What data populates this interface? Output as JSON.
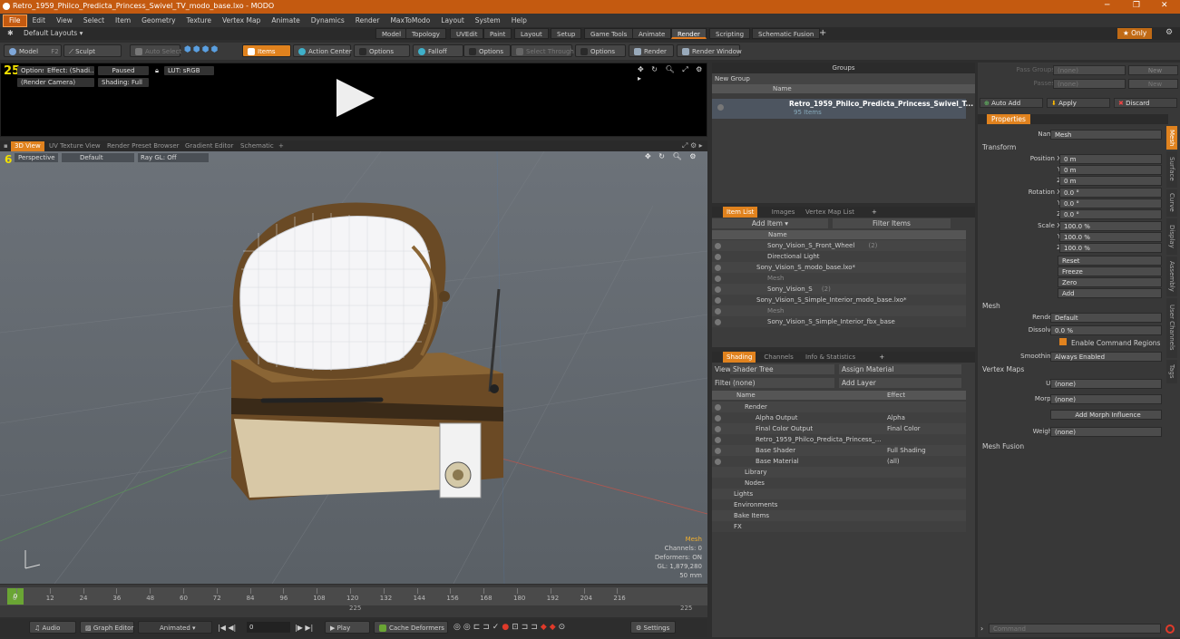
{
  "window": {
    "title": "Retro_1959_Philco_Predicta_Princess_Swivel_TV_modo_base.lxo - MODO"
  },
  "menu": [
    "File",
    "Edit",
    "View",
    "Select",
    "Item",
    "Geometry",
    "Texture",
    "Vertex Map",
    "Animate",
    "Dynamics",
    "Render",
    "MaxToModo",
    "Layout",
    "System",
    "Help"
  ],
  "layout_bar": {
    "layouts": "Default Layouts ▾",
    "tabs": [
      "Model",
      "Topology",
      "UVEdit",
      "Paint",
      "Layout",
      "Setup",
      "Game Tools",
      "Animate",
      "Render",
      "Scripting",
      "Schematic Fusion"
    ],
    "active": "Render",
    "only": "★ Only"
  },
  "toolbar": {
    "model": "Model",
    "model_key": "F2",
    "sculpt": "Sculpt",
    "auto_select": "Auto Select",
    "items": "Items",
    "action_center": "Action Center",
    "options1": "Options",
    "falloff": "Falloff",
    "options2": "Options",
    "select_through": "Select Through",
    "options3": "Options",
    "render": "Render",
    "render_window": "Render Window"
  },
  "render_view": {
    "options": "Options",
    "effect": "Effect: (Shadi...",
    "paused": "Paused",
    "lut": "LUT: sRGB",
    "camera": "(Render Camera)",
    "shading": "Shading: Full",
    "frame_num": "25"
  },
  "viewport_tabs": [
    "3D View",
    "UV Texture View",
    "Render Preset Browser",
    "Gradient Editor",
    "Schematic"
  ],
  "viewport": {
    "perspective": "Perspective",
    "default": "Default",
    "raygl": "Ray GL: Off",
    "mesh": "Mesh",
    "channels": "Channels: 0",
    "deformers": "Deformers: ON",
    "gl": "GL: 1,879,280",
    "size": "50 mm",
    "num": "6"
  },
  "timeline": {
    "ticks": [
      "0",
      "12",
      "24",
      "36",
      "48",
      "60",
      "72",
      "84",
      "96",
      "108",
      "120",
      "132",
      "144",
      "156",
      "168",
      "180",
      "192",
      "204",
      "216"
    ],
    "sub1": "225",
    "sub2": "225",
    "current": "0"
  },
  "bottom": {
    "audio": "Audio",
    "graph_editor": "Graph Editor",
    "animated": "Animated",
    "play": "Play",
    "cache": "Cache Deformers",
    "settings": "Settings",
    "frame": "0"
  },
  "groups": {
    "title": "Groups",
    "new_group": "New Group",
    "name_col": "Name",
    "item_name": "Retro_1959_Philco_Predicta_Princess_Swivel_T...",
    "item_count": "95 Items"
  },
  "item_list": {
    "tabs": [
      "Item List",
      "Images",
      "Vertex Map List"
    ],
    "add_item": "Add Item",
    "filter": "Filter Items",
    "name_col": "Name",
    "rows": [
      {
        "indent": 3,
        "label": "Sony_Vision_S_Front_Wheel",
        "suffix": "(2)",
        "grey": false
      },
      {
        "indent": 3,
        "label": "Directional Light",
        "suffix": "",
        "grey": false
      },
      {
        "indent": 2,
        "label": "Sony_Vision_S_modo_base.lxo*",
        "suffix": "",
        "grey": false
      },
      {
        "indent": 3,
        "label": "Mesh",
        "suffix": "",
        "grey": true
      },
      {
        "indent": 3,
        "label": "Sony_Vision_S",
        "suffix": "(2)",
        "grey": false
      },
      {
        "indent": 2,
        "label": "Sony_Vision_S_Simple_Interior_modo_base.lxo*",
        "suffix": "",
        "grey": false
      },
      {
        "indent": 3,
        "label": "Mesh",
        "suffix": "",
        "grey": true
      },
      {
        "indent": 3,
        "label": "Sony_Vision_S_Simple_Interior_fbx_base",
        "suffix": "",
        "grey": false
      }
    ]
  },
  "shading": {
    "tabs": [
      "Shading",
      "Channels",
      "Info & Statistics"
    ],
    "view_label": "View",
    "view_value": "Shader Tree",
    "assign": "Assign Material",
    "filter_label": "Filter",
    "filter_value": "(none)",
    "add_layer": "Add Layer",
    "name_col": "Name",
    "effect_col": "Effect",
    "rows": [
      {
        "indent": 1,
        "label": "Render",
        "effect": ""
      },
      {
        "indent": 2,
        "label": "Alpha Output",
        "effect": "Alpha"
      },
      {
        "indent": 2,
        "label": "Final Color Output",
        "effect": "Final Color"
      },
      {
        "indent": 2,
        "label": "Retro_1959_Philco_Predicta_Princess_...",
        "effect": ""
      },
      {
        "indent": 2,
        "label": "Base Shader",
        "effect": "Full Shading"
      },
      {
        "indent": 2,
        "label": "Base Material",
        "effect": "(all)"
      },
      {
        "indent": 1,
        "label": "Library",
        "effect": ""
      },
      {
        "indent": 1,
        "label": "Nodes",
        "effect": ""
      },
      {
        "indent": 0,
        "label": "Lights",
        "effect": ""
      },
      {
        "indent": 0,
        "label": "Environments",
        "effect": ""
      },
      {
        "indent": 0,
        "label": "Bake Items",
        "effect": ""
      },
      {
        "indent": 0,
        "label": "FX",
        "effect": ""
      }
    ]
  },
  "properties": {
    "pass_groups_label": "Pass Groups",
    "pass_groups_value": "(none)",
    "passes_label": "Passes",
    "passes_value": "(none)",
    "new1": "New",
    "new2": "New",
    "auto_add": "Auto Add",
    "apply": "Apply",
    "discard": "Discard",
    "tab": "Properties",
    "name_label": "Name",
    "name_value": "Mesh",
    "transform": "Transform",
    "pos_label": "Position X",
    "pos": [
      "0 m",
      "0 m",
      "0 m"
    ],
    "rot_label": "Rotation X",
    "rot": [
      "0.0 °",
      "0.0 °",
      "0.0 °"
    ],
    "scale_label": "Scale X",
    "scale": [
      "100.0 %",
      "100.0 %",
      "100.0 %"
    ],
    "y": "Y",
    "z": "Z",
    "reset": "Reset",
    "freeze": "Freeze",
    "zero": "Zero",
    "add": "Add",
    "mesh": "Mesh",
    "render_label": "Render",
    "render_value": "Default",
    "dissolve_label": "Dissolve",
    "dissolve_value": "0.0 %",
    "enable_cmd": "Enable Command Regions",
    "smoothing_label": "Smoothing",
    "smoothing_value": "Always Enabled",
    "vertex_maps": "Vertex Maps",
    "uv_label": "UV",
    "uv_value": "(none)",
    "morph_label": "Morph",
    "morph_value": "(none)",
    "add_morph": "Add Morph Influence",
    "weight_label": "Weight",
    "weight_value": "(none)",
    "mesh_fusion": "Mesh Fusion",
    "side_tabs": [
      "Mesh",
      "Surface",
      "Curve",
      "Display",
      "Assembly",
      "User Channels",
      "Tags"
    ],
    "command": "Command"
  }
}
